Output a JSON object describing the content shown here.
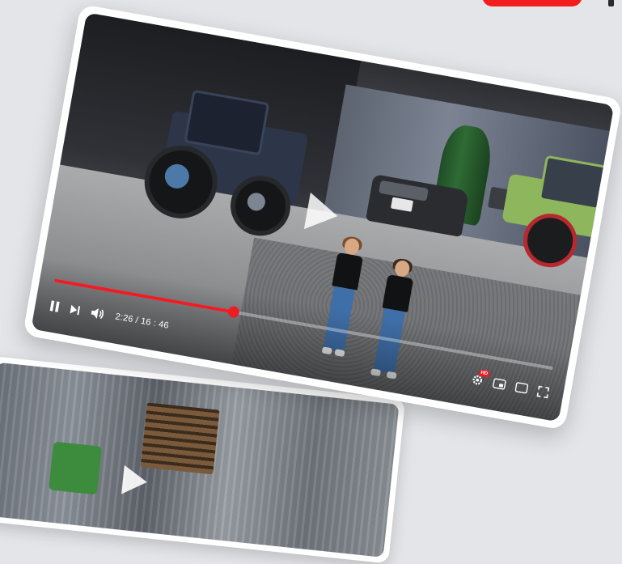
{
  "player": {
    "time_current": "2:26",
    "time_separator": " / ",
    "time_total": "16 : 46",
    "progress_fraction": 0.36,
    "hd_label": "HD",
    "accent_color": "#ee1c25"
  },
  "icons": {
    "pause": "pause-icon",
    "next": "next-icon",
    "volume": "volume-icon",
    "settings": "gear-icon",
    "miniplayer": "miniplayer-icon",
    "theater": "theater-icon",
    "fullscreen": "fullscreen-icon",
    "play_overlay": "play-icon"
  },
  "colors": {
    "brand_red": "#f21d1d",
    "background": "#e4e5e9"
  }
}
